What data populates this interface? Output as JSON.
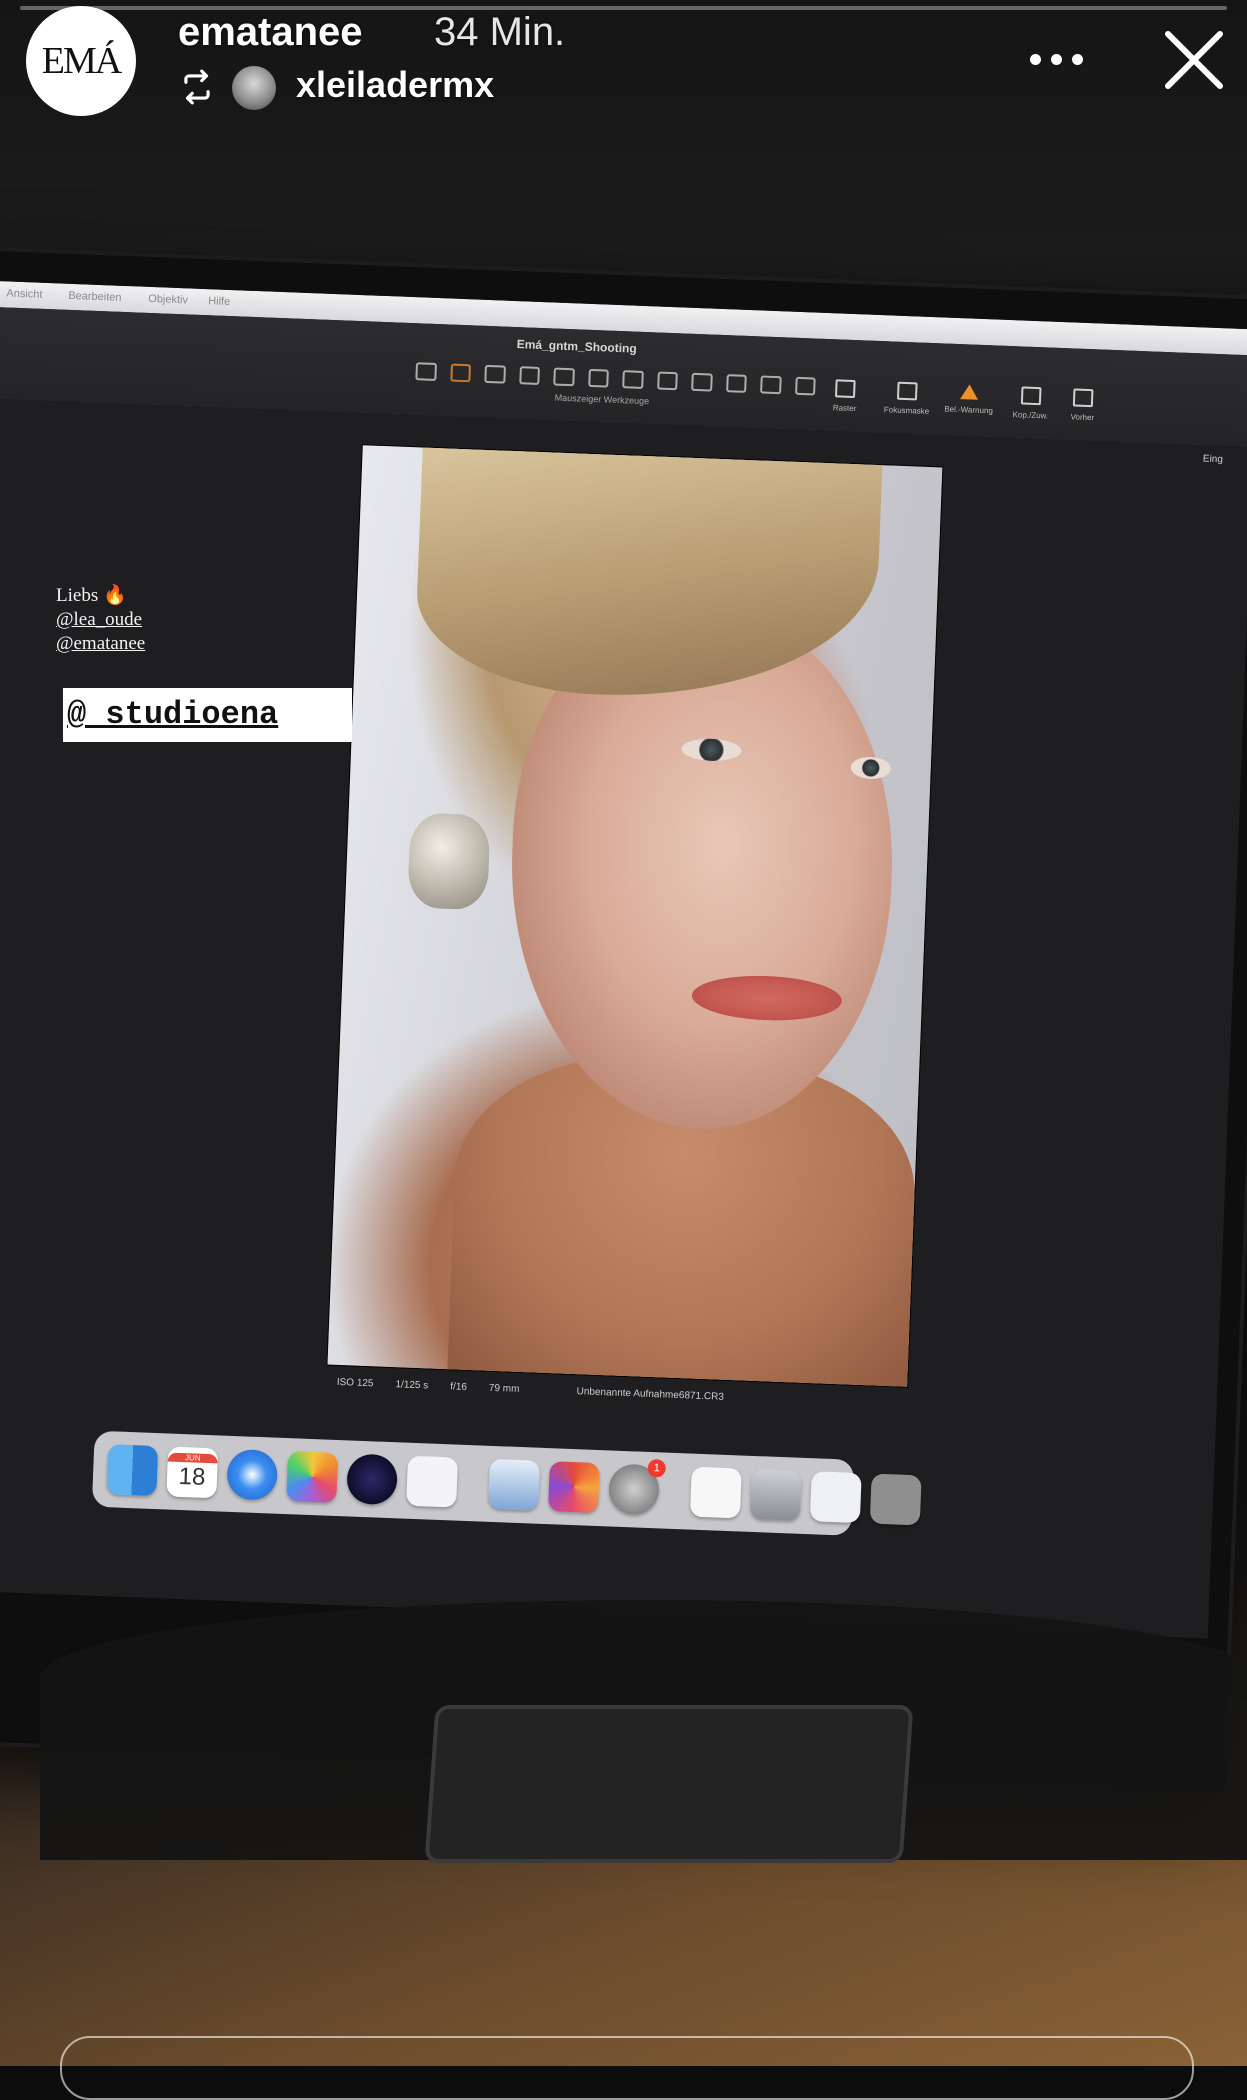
{
  "story": {
    "username": "ematanee",
    "time_ago": "34 Min.",
    "avatar_text": "EMÁ",
    "reposted_from": "xleiladermx"
  },
  "stickers": {
    "credits": [
      "Liebs 🔥",
      "@lea_oude",
      "@ematanee"
    ],
    "tag": "@_studioena"
  },
  "editor": {
    "document_title": "Emá_gntm_Shooting",
    "tool_caption": "Mauszeiger Werkzeuge",
    "right_tools": [
      "Raster",
      "Fokusmaske",
      "Bel.-Warnung",
      "Kop./Zuw.",
      "Vorher"
    ],
    "edge_label": "Eing",
    "menu_items": [
      "Ansicht",
      "Bearbeiten",
      "Objektiv",
      "Hilfe"
    ],
    "photo_info": [
      "ISO 125",
      "1/125 s",
      "f/16",
      "79 mm"
    ],
    "filename": "Unbenannte Aufnahme6871.CR3"
  },
  "dock": {
    "calendar_month": "JUN",
    "calendar_day": "18",
    "badge_count": "1"
  },
  "colors": {
    "accent_orange": "#f0902a",
    "badge_red": "#f03a2e"
  }
}
